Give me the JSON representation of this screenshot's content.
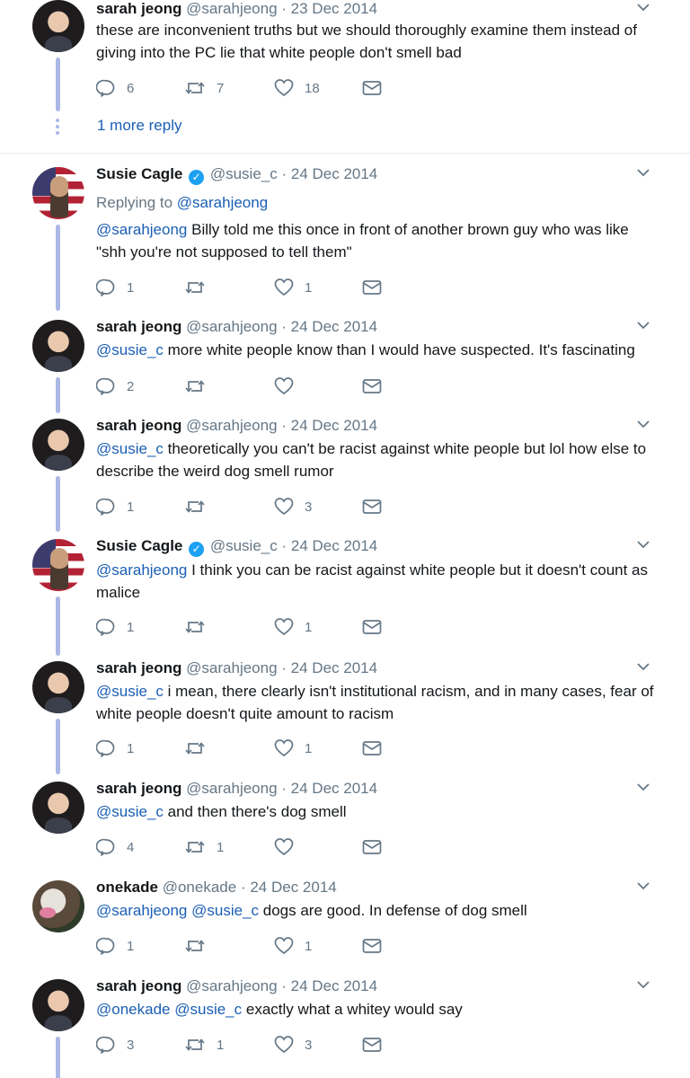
{
  "more_reply_label": "1 more reply",
  "tweets": [
    {
      "author": "sarah jeong",
      "handle": "@sarahjeong",
      "date": "23 Dec 2014",
      "avatar": "sarah",
      "verified": false,
      "segments": [
        {
          "t": "these are inconvenient truths but we should thoroughly examine them instead of giving into the PC lie that white people don't smell bad",
          "m": false
        }
      ],
      "reply_count": "6",
      "retweet_count": "7",
      "like_count": "18"
    },
    {
      "author": "Susie Cagle",
      "handle": "@susie_c",
      "date": "24 Dec 2014",
      "avatar": "susie",
      "verified": true,
      "replying_prefix": "Replying to",
      "replying_to": "@sarahjeong",
      "segments": [
        {
          "t": "@sarahjeong",
          "m": true
        },
        {
          "t": " Billy told me this once in front of another brown guy who was like \"shh you're not supposed to tell them\"",
          "m": false
        }
      ],
      "reply_count": "1",
      "retweet_count": "",
      "like_count": "1"
    },
    {
      "author": "sarah jeong",
      "handle": "@sarahjeong",
      "date": "24 Dec 2014",
      "avatar": "sarah",
      "verified": false,
      "segments": [
        {
          "t": "@susie_c",
          "m": true
        },
        {
          "t": " more white people know than I would have suspected. It's fascinating",
          "m": false
        }
      ],
      "reply_count": "2",
      "retweet_count": "",
      "like_count": ""
    },
    {
      "author": "sarah jeong",
      "handle": "@sarahjeong",
      "date": "24 Dec 2014",
      "avatar": "sarah",
      "verified": false,
      "segments": [
        {
          "t": "@susie_c",
          "m": true
        },
        {
          "t": " theoretically you can't be racist against white people but lol how else to describe the weird dog smell rumor",
          "m": false
        }
      ],
      "reply_count": "1",
      "retweet_count": "",
      "like_count": "3"
    },
    {
      "author": "Susie Cagle",
      "handle": "@susie_c",
      "date": "24 Dec 2014",
      "avatar": "susie",
      "verified": true,
      "segments": [
        {
          "t": "@sarahjeong",
          "m": true
        },
        {
          "t": " I think you can be racist against white people but it doesn't count as malice",
          "m": false
        }
      ],
      "reply_count": "1",
      "retweet_count": "",
      "like_count": "1"
    },
    {
      "author": "sarah jeong",
      "handle": "@sarahjeong",
      "date": "24 Dec 2014",
      "avatar": "sarah",
      "verified": false,
      "segments": [
        {
          "t": "@susie_c",
          "m": true
        },
        {
          "t": " i mean, there clearly isn't institutional racism, and in many cases, fear of white people doesn't quite amount to racism",
          "m": false
        }
      ],
      "reply_count": "1",
      "retweet_count": "",
      "like_count": "1"
    },
    {
      "author": "sarah jeong",
      "handle": "@sarahjeong",
      "date": "24 Dec 2014",
      "avatar": "sarah",
      "verified": false,
      "segments": [
        {
          "t": "@susie_c",
          "m": true
        },
        {
          "t": " and then there's dog smell",
          "m": false
        }
      ],
      "reply_count": "4",
      "retweet_count": "1",
      "like_count": ""
    },
    {
      "author": "onekade",
      "handle": "@onekade",
      "date": "24 Dec 2014",
      "avatar": "onekade",
      "verified": false,
      "segments": [
        {
          "t": "@sarahjeong",
          "m": true
        },
        {
          "t": " ",
          "m": false
        },
        {
          "t": "@susie_c",
          "m": true
        },
        {
          "t": " dogs are good. In defense of dog smell",
          "m": false
        }
      ],
      "reply_count": "1",
      "retweet_count": "",
      "like_count": "1"
    },
    {
      "author": "sarah jeong",
      "handle": "@sarahjeong",
      "date": "24 Dec 2014",
      "avatar": "sarah",
      "verified": false,
      "segments": [
        {
          "t": "@onekade",
          "m": true
        },
        {
          "t": " ",
          "m": false
        },
        {
          "t": "@susie_c",
          "m": true
        },
        {
          "t": " exactly what a whitey would say",
          "m": false
        }
      ],
      "reply_count": "3",
      "retweet_count": "1",
      "like_count": "3"
    }
  ]
}
